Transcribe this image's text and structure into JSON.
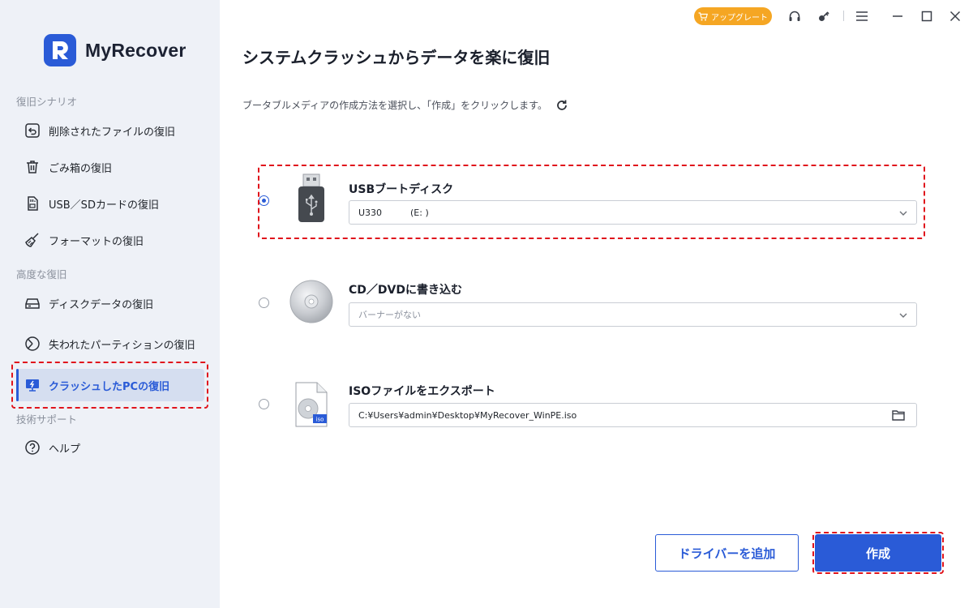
{
  "app": {
    "name": "MyRecover"
  },
  "sidebar": {
    "sections": [
      {
        "label": "復旧シナリオ"
      },
      {
        "label": "高度な復旧"
      },
      {
        "label": "技術サポート"
      }
    ],
    "items": [
      {
        "label": "削除されたファイルの復旧",
        "icon": "undo-box-icon"
      },
      {
        "label": "ごみ箱の復旧",
        "icon": "trash-icon"
      },
      {
        "label": "USB／SDカードの復旧",
        "icon": "sd-card-icon"
      },
      {
        "label": "フォーマットの復旧",
        "icon": "broom-icon"
      },
      {
        "label": "ディスクデータの復旧",
        "icon": "hard-disk-icon"
      },
      {
        "label": "失われたパーティションの復旧",
        "icon": "partition-pie-icon"
      },
      {
        "label": "クラッシュしたPCの復旧",
        "icon": "crashed-pc-icon",
        "active": true
      },
      {
        "label": "ヘルプ",
        "icon": "help-icon"
      }
    ]
  },
  "titlebar": {
    "upgrade_label": "アップグレート"
  },
  "main": {
    "title": "システムクラッシュからデータを楽に復旧",
    "instruction": "ブータブルメディアの作成方法を選択し、「作成」をクリックします。",
    "options": [
      {
        "label": "USBブートディスク",
        "value": "U330          (E: )",
        "selected": true,
        "icon": "usb-drive-icon"
      },
      {
        "label": "CD／DVDに書き込む",
        "value": "バーナーがない",
        "selected": false,
        "icon": "cd-disc-icon"
      },
      {
        "label": "ISOファイルをエクスポート",
        "value": "C:¥Users¥admin¥Desktop¥MyRecover_WinPE.iso",
        "selected": false,
        "icon": "iso-file-icon"
      }
    ],
    "buttons": {
      "add_driver": "ドライバーを追加",
      "create": "作成"
    }
  },
  "colors": {
    "accent": "#2a5bd7",
    "upgrade": "#f5a623",
    "highlight": "#e0141c",
    "sidebar_bg": "#eef1f7"
  }
}
